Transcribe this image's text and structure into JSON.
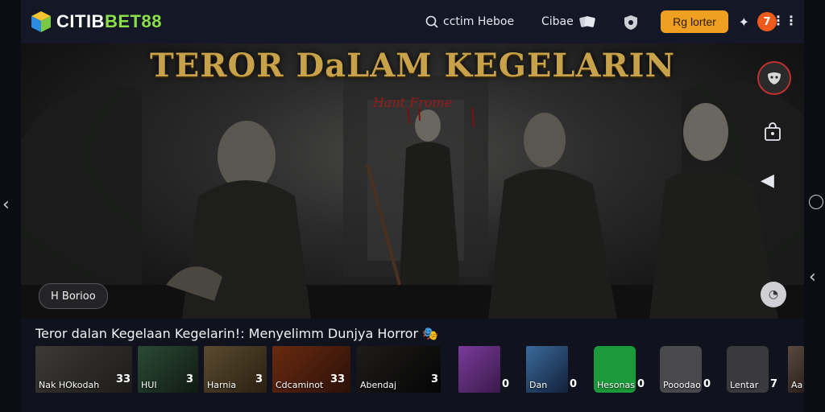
{
  "logo": {
    "text_white": "CITIB",
    "text_green": "BET88"
  },
  "header": {
    "search_label": "cctim Heboe",
    "nav_label": "Cibae",
    "login_label": "Rg lorter",
    "avatar_initial": "7"
  },
  "hero": {
    "title": "TEROR DaLAM KEGELARIN",
    "subtitle": "Hant Frome",
    "badge_label": "H Borioo"
  },
  "strip": {
    "title": "Teror dalan Kegelaan Kegelarin!: Menyelimm Dunjya Horror",
    "title_suffix": "🎭",
    "items": [
      {
        "label": "Nak HOkodah",
        "count": "33"
      },
      {
        "label": "HUI",
        "count": "3"
      },
      {
        "label": "Harnia",
        "count": "3"
      },
      {
        "label": "Cdcaminot",
        "count": "33"
      },
      {
        "label": "Abendaj",
        "count": "3"
      },
      {
        "label": "",
        "count": "0"
      },
      {
        "label": "Dan",
        "count": "0"
      },
      {
        "label": "Hesonas",
        "count": "0"
      },
      {
        "label": "Pooodao",
        "count": "0"
      },
      {
        "label": "Lentar",
        "count": "7"
      },
      {
        "label": "Aa",
        "count": ""
      }
    ]
  },
  "colors": {
    "accent": "#f0a020",
    "brand_green": "#8be04a",
    "avatar": "#ee5a1c",
    "header_bg": "#131726"
  },
  "icons": [
    "cube-logo-icon",
    "search-icon",
    "cards-icon",
    "shield-icon",
    "login-button",
    "star-icon",
    "more-icon",
    "chevron-left-icon",
    "chevron-right-icon",
    "circle-icon",
    "mask-icon",
    "bag-icon",
    "share-icon",
    "hero-round-icon"
  ]
}
